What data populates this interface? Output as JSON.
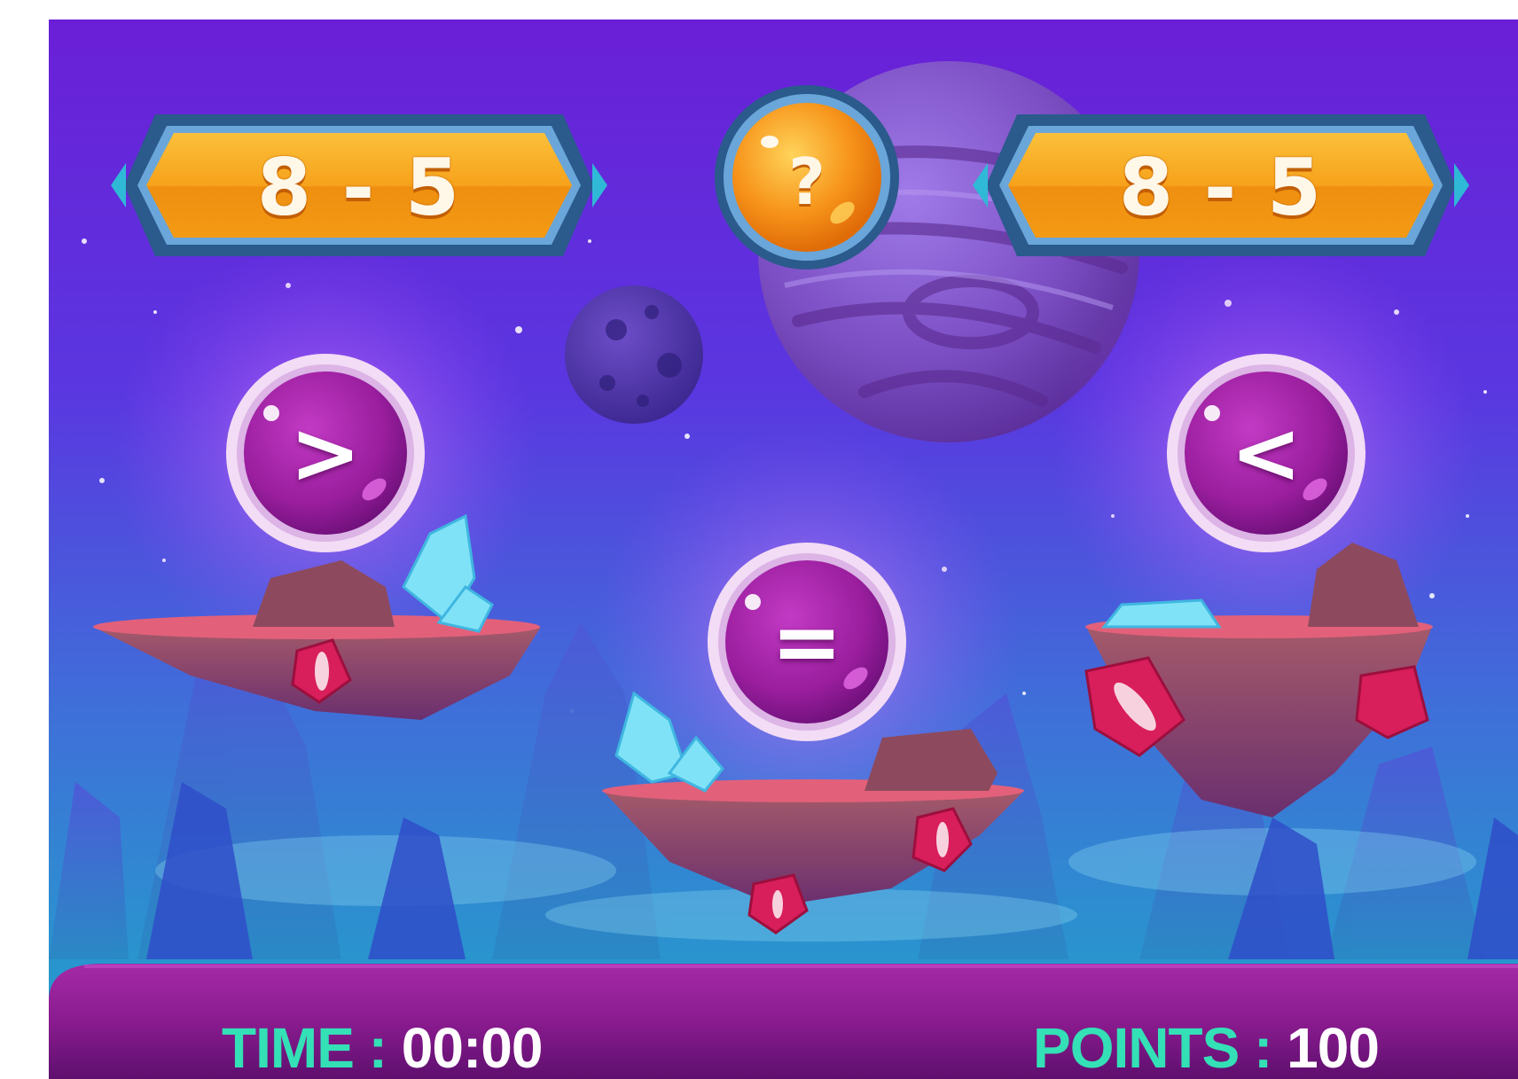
{
  "hud": {
    "left_expression": "8 - 5",
    "right_expression": "8 - 5",
    "hint_symbol": "?"
  },
  "buttons": {
    "greater_symbol": ">",
    "equal_symbol": "=",
    "less_symbol": "<"
  },
  "status": {
    "time_label": "TIME",
    "time_separator": ":",
    "time_value": "00:00",
    "points_label": "POINTS",
    "points_separator": ":",
    "points_value": "100"
  },
  "colors": {
    "sky_top": "#6a1fd6",
    "sky_bottom": "#1fa6c9",
    "panel_orange": "#f7a21b",
    "orb_purple": "#9a1e9e",
    "status_bar": "#8a1b8f",
    "label_teal": "#34e0b5"
  }
}
